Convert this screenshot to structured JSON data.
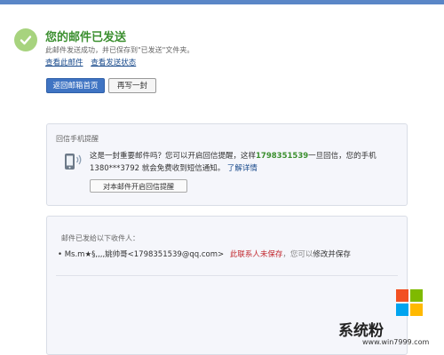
{
  "header": {
    "title": "您的邮件已发送",
    "description": "此邮件发送成功，并已保存到\"已发送\"文件夹。",
    "links": [
      "查看此邮件",
      "查看发送状态"
    ]
  },
  "actions": {
    "back_label": "返回邮箱首页",
    "write_again_label": "再写一封"
  },
  "reply_reminder": {
    "title": "回信手机提醒",
    "text_1": "这是一封重要邮件吗？您可以开启回信提醒，这样",
    "number": "1798351539",
    "text_2": "一旦回信，您的手机1380***3792 就会免费收到短信通知。",
    "learn_more": "了解详情",
    "enable_button": "对本邮件开启回信提醒"
  },
  "recipients": {
    "title": "邮件已发给以下收件人：",
    "items": [
      {
        "bullet": "•",
        "name": "Ms.m★§,,,,姚帅哥<1798351539@qq.com>",
        "status": "此联系人未保存",
        "separator": "，您可以",
        "save_link": "修改并保存"
      }
    ]
  },
  "watermark": {
    "brand": "系统粉",
    "url": "www.win7999.com"
  },
  "colors": {
    "accent": "#3f74c3",
    "success": "#3b8f2f",
    "warning": "#c2272d"
  }
}
